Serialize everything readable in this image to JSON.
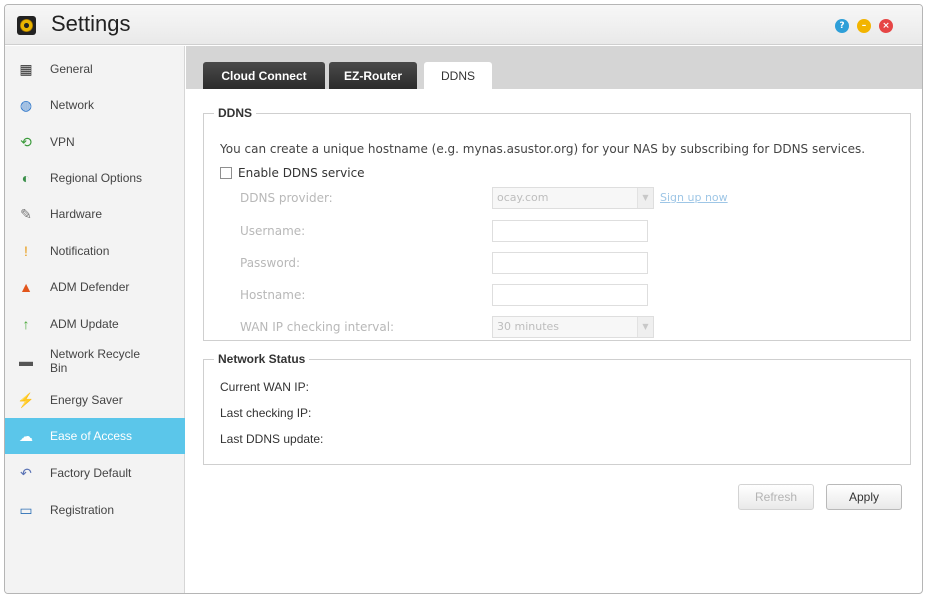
{
  "window": {
    "title": "Settings"
  },
  "sidebar": {
    "items": [
      {
        "label": "General",
        "icon": "general-icon",
        "glyph": "▦",
        "color": "#333333"
      },
      {
        "label": "Network",
        "icon": "network-globe-icon",
        "glyph": "◍",
        "color": "#2a74c9"
      },
      {
        "label": "VPN",
        "icon": "vpn-icon",
        "glyph": "⟲",
        "color": "#3a9a3a"
      },
      {
        "label": "Regional Options",
        "icon": "regional-options-icon",
        "glyph": "◐",
        "color": "#3a8f4a"
      },
      {
        "label": "Hardware",
        "icon": "hardware-wrench-icon",
        "glyph": "✎",
        "color": "#777777"
      },
      {
        "label": "Notification",
        "icon": "notification-icon",
        "glyph": "!",
        "color": "#e79a14"
      },
      {
        "label": "ADM Defender",
        "icon": "adm-defender-icon",
        "glyph": "▲",
        "color": "#e2551b"
      },
      {
        "label": "ADM Update",
        "icon": "adm-update-arrow-icon",
        "glyph": "↑",
        "color": "#4aa93a"
      },
      {
        "label": "Network Recycle Bin",
        "icon": "recycle-bin-icon",
        "glyph": "▬",
        "color": "#555555"
      },
      {
        "label": "Energy Saver",
        "icon": "energy-saver-icon",
        "glyph": "⚡",
        "color": "#2b4fa8"
      },
      {
        "label": "Ease of Access",
        "icon": "ease-of-access-cloud-icon",
        "glyph": "☁",
        "color": "#ffffff"
      },
      {
        "label": "Factory Default",
        "icon": "factory-default-arrow-icon",
        "glyph": "↶",
        "color": "#5b74b5"
      },
      {
        "label": "Registration",
        "icon": "registration-icon",
        "glyph": "▭",
        "color": "#2c6fb5"
      }
    ],
    "active_index": 10
  },
  "tabs": [
    {
      "label": "Cloud Connect"
    },
    {
      "label": "EZ-Router"
    },
    {
      "label": "DDNS"
    }
  ],
  "ddns": {
    "legend": "DDNS",
    "description": "You can create a unique hostname (e.g. mynas.asustor.org) for your NAS by subscribing for DDNS services.",
    "enable_label": "Enable DDNS service",
    "provider_label": "DDNS provider:",
    "provider_value": "ocay.com",
    "signup_link": "Sign up now",
    "username_label": "Username:",
    "password_label": "Password:",
    "hostname_label": "Hostname:",
    "interval_label": "WAN IP checking interval:",
    "interval_value": "30 minutes"
  },
  "network_status": {
    "legend": "Network Status",
    "current_wan_ip": "Current WAN IP:",
    "last_checking_ip": "Last checking IP:",
    "last_ddns_update": "Last DDNS update:"
  },
  "buttons": {
    "refresh": "Refresh",
    "apply": "Apply"
  }
}
